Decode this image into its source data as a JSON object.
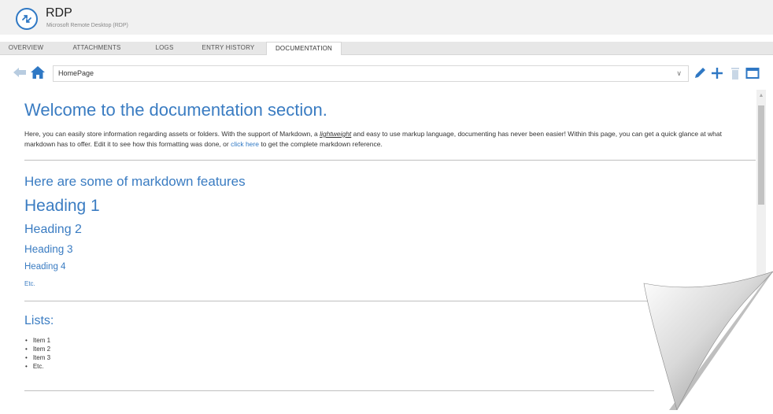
{
  "header": {
    "title": "RDP",
    "subtitle": "Microsoft Remote Desktop (RDP)",
    "logo_icon": "rdp-connection-icon"
  },
  "tabs": [
    {
      "label": "OVERVIEW",
      "active": false
    },
    {
      "label": "ATTACHMENTS",
      "active": false
    },
    {
      "label": "LOGS",
      "active": false
    },
    {
      "label": "ENTRY HISTORY",
      "active": false
    },
    {
      "label": "DOCUMENTATION",
      "active": true
    }
  ],
  "toolbar": {
    "page_value": "HomePage",
    "icons": [
      "back-arrow-icon",
      "home-icon",
      "pencil-icon",
      "plus-icon",
      "trash-icon",
      "window-icon"
    ]
  },
  "content": {
    "title": "Welcome to the documentation section.",
    "intro_1": "Here, you can easily store information regarding assets or folders. With the support of Markdown, a ",
    "intro_emph": "lightweight",
    "intro_2": " and easy to use markup language, documenting has never been easier! Within this page, you can get a quick glance at what markdown has to offer. Edit it to see how this formatting was done, or ",
    "intro_link": "click here",
    "intro_3": " to get the complete markdown reference.",
    "features_heading": "Here are some of markdown features",
    "heading1": "Heading 1",
    "heading2": "Heading 2",
    "heading3": "Heading 3",
    "heading4": "Heading 4",
    "etc": "Etc.",
    "lists_heading": "Lists:",
    "list_items": [
      "Item 1",
      "Item 2",
      "Item 3",
      "Etc."
    ]
  },
  "colors": {
    "accent": "#3a7cc2",
    "link": "#2f78c4",
    "icon_blue": "#2f78c4",
    "icon_grey": "#b8cce0"
  }
}
